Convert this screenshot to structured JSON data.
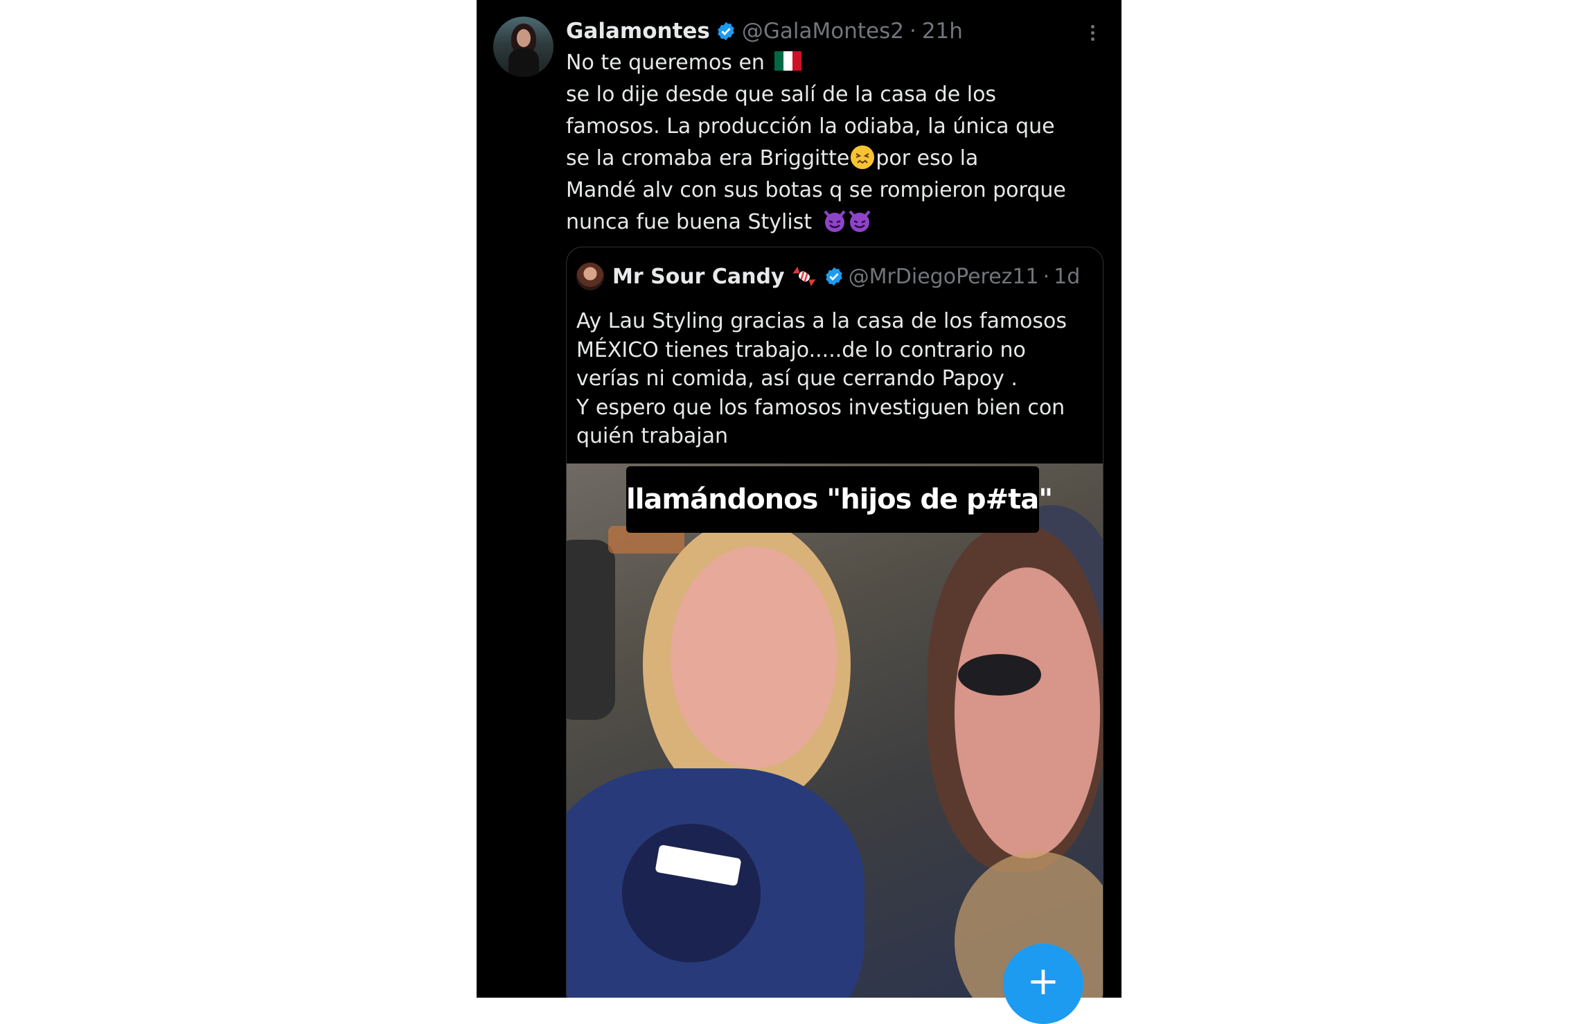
{
  "tweet": {
    "display_name": "Galamontes",
    "handle": "@GalaMontes2",
    "time": "21h",
    "lines": [
      "No te queremos en",
      "se lo dije desde que salí de la casa de los",
      "famosos. La producción la odiaba, la única que",
      "se la cromaba era Briggitte",
      "por eso la",
      "Mandé alv con sus botas  q se rompieron porque",
      "nunca fue buena Stylist"
    ]
  },
  "quoted": {
    "display_name": "Mr Sour Candy",
    "handle": "@MrDiegoPerez11",
    "time": "1d",
    "lines": [
      "Ay Lau Styling gracias a la casa de los famosos",
      "MÉXICO tienes trabajo.....de lo contrario no",
      "verías ni comida, así que cerrando Papoy .",
      "Y espero que los famosos investiguen bien con",
      "quién trabajan"
    ],
    "media_caption": "llamándonos \"hijos de p#ta\""
  },
  "fab_label": "+",
  "icons": {
    "verified": "verified-badge-icon",
    "more": "more-options-icon",
    "mexico_flag": "mexico-flag-emoji",
    "confounded": "confounded-face-emoji",
    "devil": "smiling-devil-emoji",
    "candy": "candy-emoji"
  },
  "colors": {
    "background": "#000000",
    "text": "#e7e9ea",
    "secondary": "#71767b",
    "accent": "#1d9bf0",
    "border": "#2f3336"
  }
}
